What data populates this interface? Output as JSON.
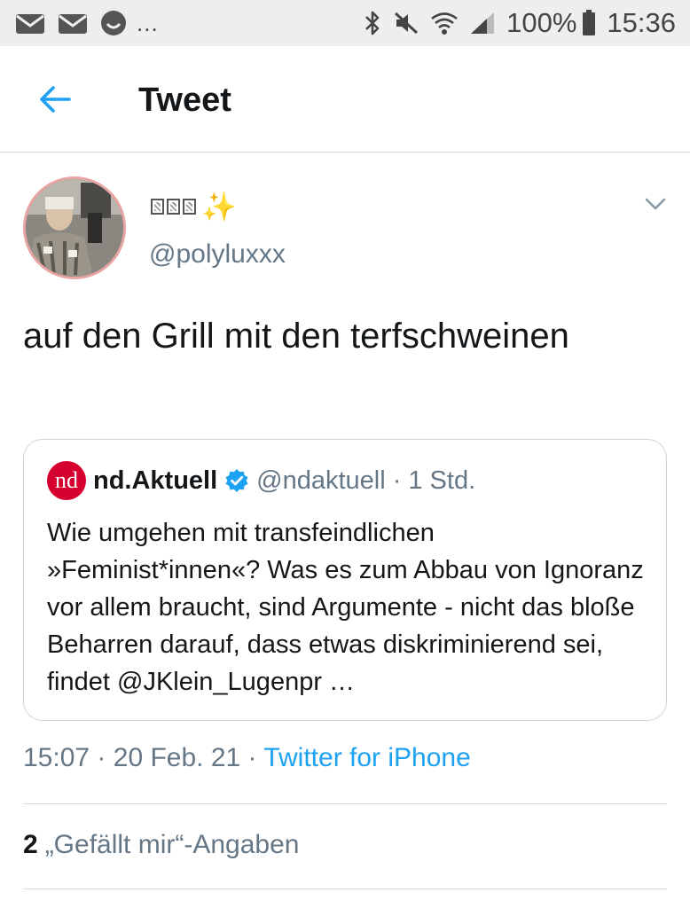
{
  "status_bar": {
    "left_icons": [
      "gmail-icon",
      "gmail-icon",
      "messenger-icon"
    ],
    "more": "...",
    "right_icons": [
      "bluetooth-icon",
      "mute-icon",
      "wifi-icon",
      "signal-icon"
    ],
    "battery": "100%",
    "time": "15:36"
  },
  "app_bar": {
    "back_icon": "arrow-left-icon",
    "title": "Tweet"
  },
  "tweet": {
    "display_name_emoji": "✨",
    "handle": "@polyluxxx",
    "text": "auf den Grill mit den terfschweinen",
    "quote": {
      "logo": "nd",
      "name": "nd.Aktuell",
      "handle": "@ndaktuell",
      "separator": "·",
      "time": "1 Std.",
      "text": "Wie umgehen mit transfeindlichen »Feminist*innen«? Was es zum Abbau von Ignoranz vor allem braucht, sind Argumente - nicht das bloße Beharren darauf, dass etwas diskriminierend sei, findet @JKlein_Lugenpr …"
    },
    "meta": {
      "time": "15:07",
      "sep1": "·",
      "date": "20 Feb. 21",
      "sep2": "·",
      "source": "Twitter for iPhone"
    },
    "likes": {
      "count": "2",
      "label": "„Gefällt mir“-Angaben"
    }
  },
  "colors": {
    "accent": "#1da1f2",
    "secondary_text": "#657786",
    "divider": "#d7dce0",
    "status_bar_bg": "#eeeeee",
    "nd_red": "#d6002f",
    "avatar_ring": "#e9a4a4"
  }
}
